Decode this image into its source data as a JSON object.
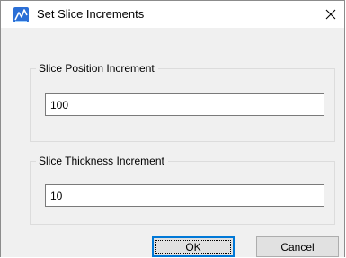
{
  "window": {
    "title": "Set Slice Increments",
    "close_glyph": "✕"
  },
  "icons": {
    "app": "app-logo-icon",
    "close": "close-icon"
  },
  "position_group": {
    "label": "Slice Position Increment",
    "value": "100"
  },
  "thickness_group": {
    "label": "Slice Thickness Increment",
    "value": "10"
  },
  "buttons": {
    "ok_label": "OK",
    "cancel_label": "Cancel"
  },
  "colors": {
    "dialog_background": "#f0f0f0",
    "titlebar_background": "#ffffff",
    "default_button_border": "#0078d7",
    "app_icon": "#2b6fd6"
  }
}
